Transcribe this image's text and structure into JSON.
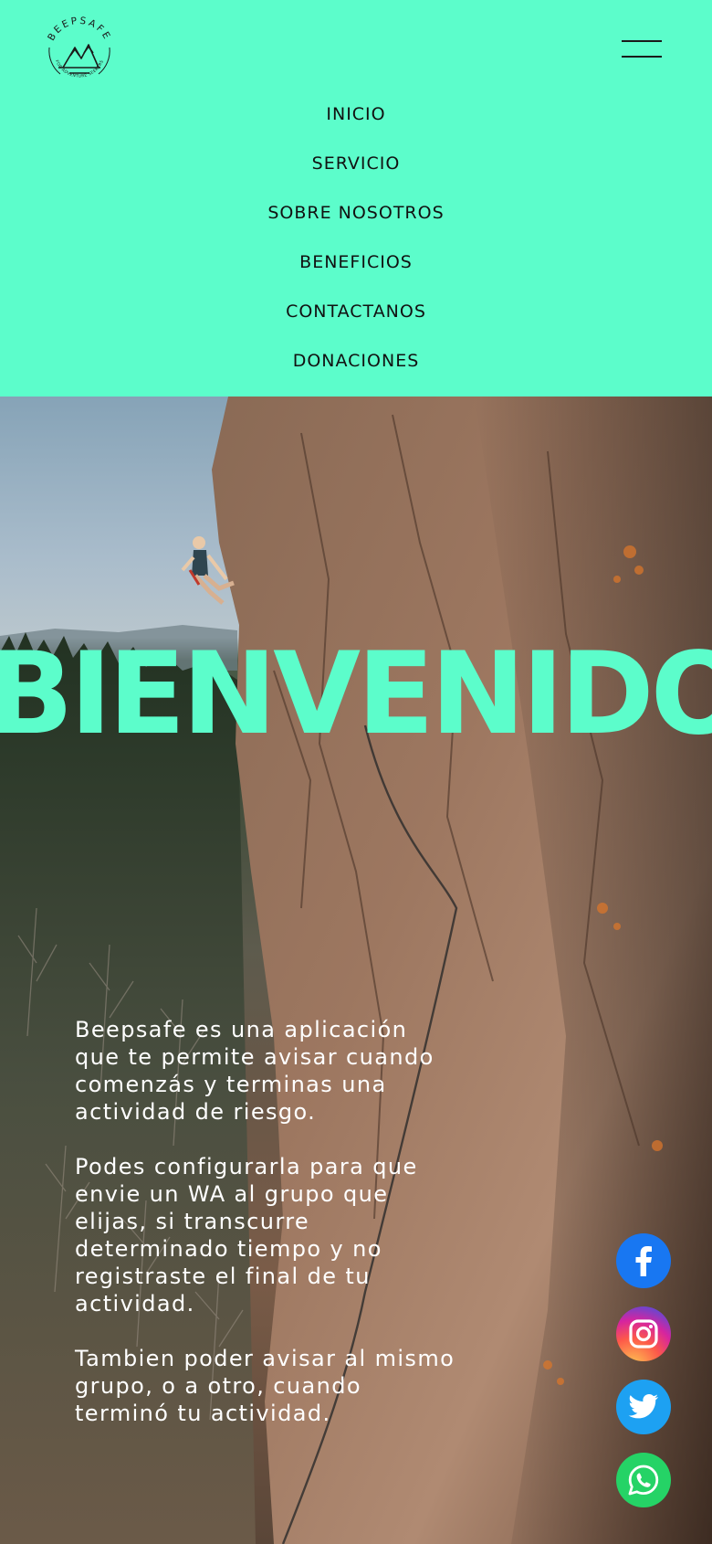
{
  "brand": {
    "name": "BEEPSAFE",
    "tagline": "FOR ADVENTURE SEEKERS"
  },
  "header": {
    "menu_icon": "hamburger-icon"
  },
  "nav": {
    "items": [
      {
        "label": "INICIO"
      },
      {
        "label": "SERVICIO"
      },
      {
        "label": "SOBRE NOSOTROS"
      },
      {
        "label": "BENEFICIOS"
      },
      {
        "label": "CONTACTANOS"
      },
      {
        "label": "DONACIONES"
      }
    ]
  },
  "hero": {
    "headline": "BIENVENIDO",
    "paragraphs": [
      "Beepsafe es una aplicación que te permite avisar cuando comenzás y terminas una actividad de riesgo.",
      "Podes configurarla para que envie un WA al grupo que elijas, si transcurre determinado tiempo y no registraste el final de tu actividad.",
      "Tambien poder avisar al mismo grupo, o a otro, cuando terminó tu actividad."
    ]
  },
  "social": {
    "items": [
      {
        "icon": "facebook-icon",
        "color": "#1877f2"
      },
      {
        "icon": "instagram-icon",
        "color": "#d6249f"
      },
      {
        "icon": "twitter-icon",
        "color": "#1da1f2"
      },
      {
        "icon": "whatsapp-icon",
        "color": "#25d366"
      }
    ]
  },
  "colors": {
    "accent": "#5cfdcb",
    "text_dark": "#111111",
    "text_light": "#ffffff"
  }
}
